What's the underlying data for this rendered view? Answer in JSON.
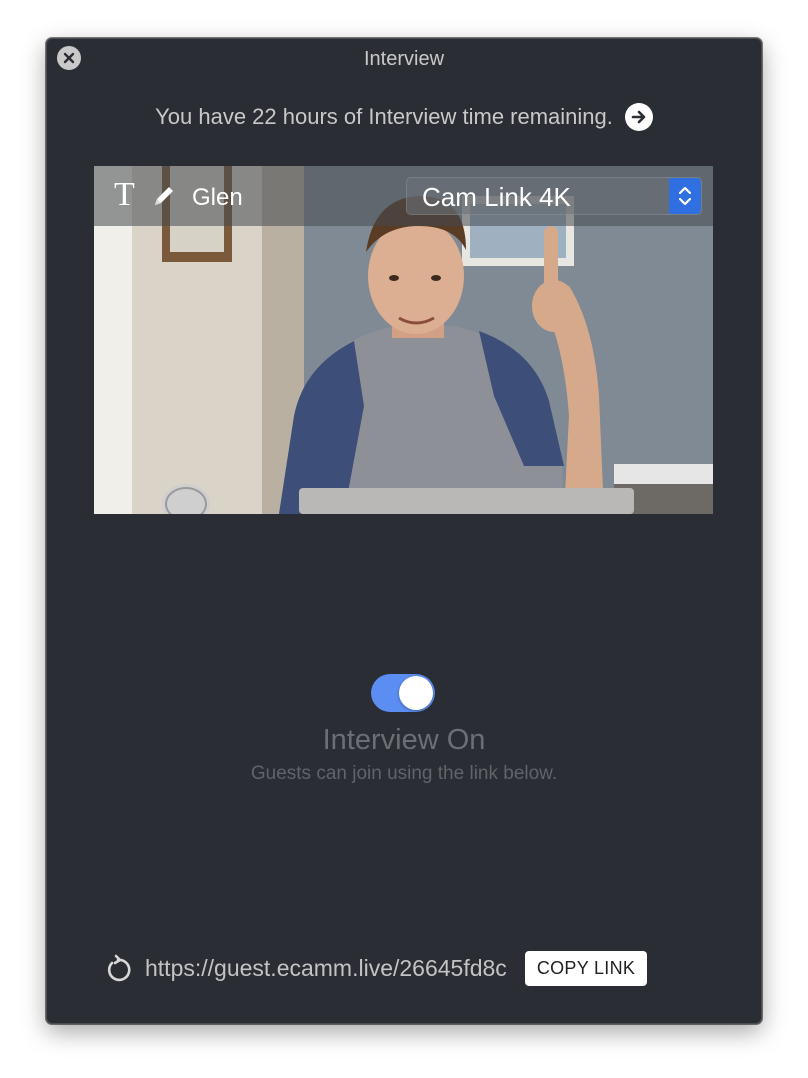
{
  "window": {
    "title": "Interview"
  },
  "notice": {
    "time_remaining_text": "You have 22 hours of Interview time remaining."
  },
  "video": {
    "text_tool_glyph": "T",
    "guest_name": "Glen",
    "camera_selected": "Cam Link 4K"
  },
  "interview": {
    "toggle_on": true,
    "status_title": "Interview On",
    "status_subtitle": "Guests can join using the link below."
  },
  "link": {
    "url": "https://guest.ecamm.live/26645fd8c",
    "copy_label": "COPY LINK"
  },
  "colors": {
    "window_bg": "#2a2d33",
    "toggle_accent": "#5b8df2",
    "select_stepper": "#2f6fe0"
  },
  "icons": {
    "close": "close-icon",
    "arrow": "arrow-right-icon",
    "pencil": "pencil-icon",
    "stepper": "chevron-up-down-icon",
    "refresh": "refresh-icon"
  }
}
